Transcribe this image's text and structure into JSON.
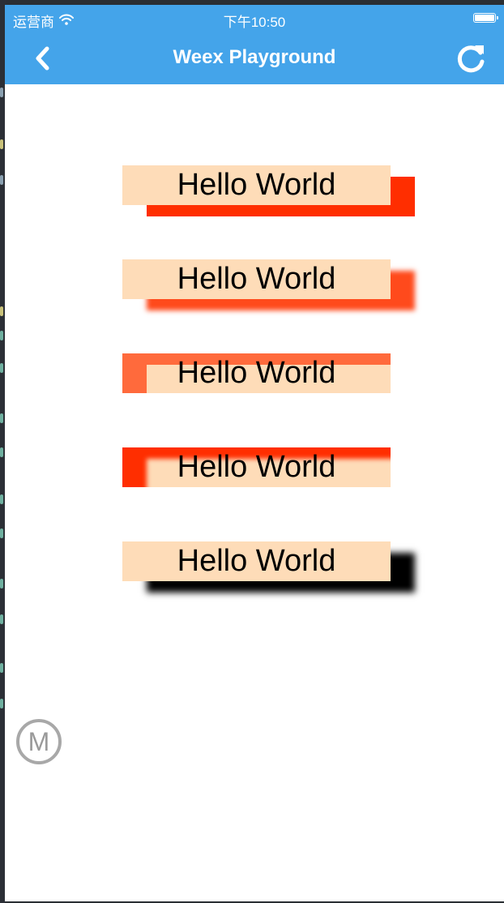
{
  "status_bar": {
    "carrier": "运营商",
    "wifi_icon": "wifi-icon",
    "time": "下午10:50",
    "battery_icon": "battery-icon"
  },
  "nav": {
    "title": "Weex Playground",
    "back_icon": "chevron-left-icon",
    "refresh_icon": "refresh-icon"
  },
  "boxes": [
    {
      "text": "Hello World",
      "shadow_color": "#ff2e00",
      "shadow_blur": "none"
    },
    {
      "text": "Hello World",
      "shadow_color": "#ff4a1c",
      "shadow_blur": "soft"
    },
    {
      "text": "Hello World",
      "shadow_color": "#ff6a3c",
      "shadow_blur": "none"
    },
    {
      "text": "Hello World",
      "shadow_color": "#ff2e00",
      "shadow_blur": "soft"
    },
    {
      "text": "Hello World",
      "shadow_color": "#000000",
      "shadow_blur": "soft"
    }
  ],
  "float_button": {
    "label": "M"
  },
  "colors": {
    "nav_bg": "#44a4ea",
    "box_bg": "#fedcb8"
  }
}
